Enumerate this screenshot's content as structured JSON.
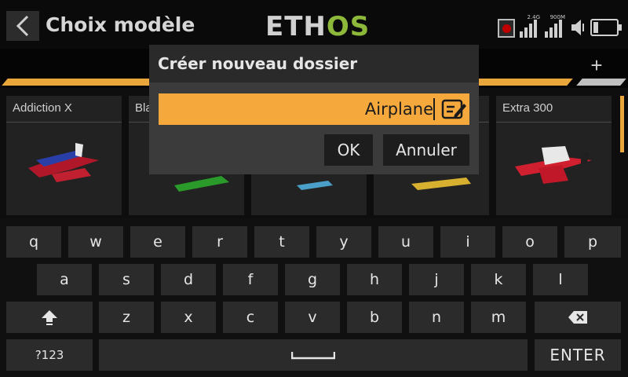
{
  "header": {
    "title": "Choix modèle",
    "logo_part1": "ETH",
    "logo_part2": "OS",
    "status": {
      "sig1_label": "2.4G",
      "sig2_label": "900M"
    }
  },
  "tabs": {
    "add_label": "+"
  },
  "models": [
    {
      "name": "Addiction X"
    },
    {
      "name": "Bla"
    },
    {
      "name": ""
    },
    {
      "name": ""
    },
    {
      "name": "Extra 300"
    }
  ],
  "dialog": {
    "title": "Créer nouveau dossier",
    "field_value": "Airplane",
    "ok_label": "OK",
    "cancel_label": "Annuler"
  },
  "keyboard": {
    "row1": [
      "q",
      "w",
      "e",
      "r",
      "t",
      "y",
      "u",
      "i",
      "o",
      "p"
    ],
    "row2": [
      "a",
      "s",
      "d",
      "f",
      "g",
      "h",
      "j",
      "k",
      "l"
    ],
    "row3": [
      "z",
      "x",
      "c",
      "v",
      "b",
      "n",
      "m"
    ],
    "numbers_label": "?123",
    "enter_label": "ENTER"
  },
  "colors": {
    "accent": "#f5a93c",
    "logo_green": "#8db83a",
    "record": "#c00000"
  }
}
